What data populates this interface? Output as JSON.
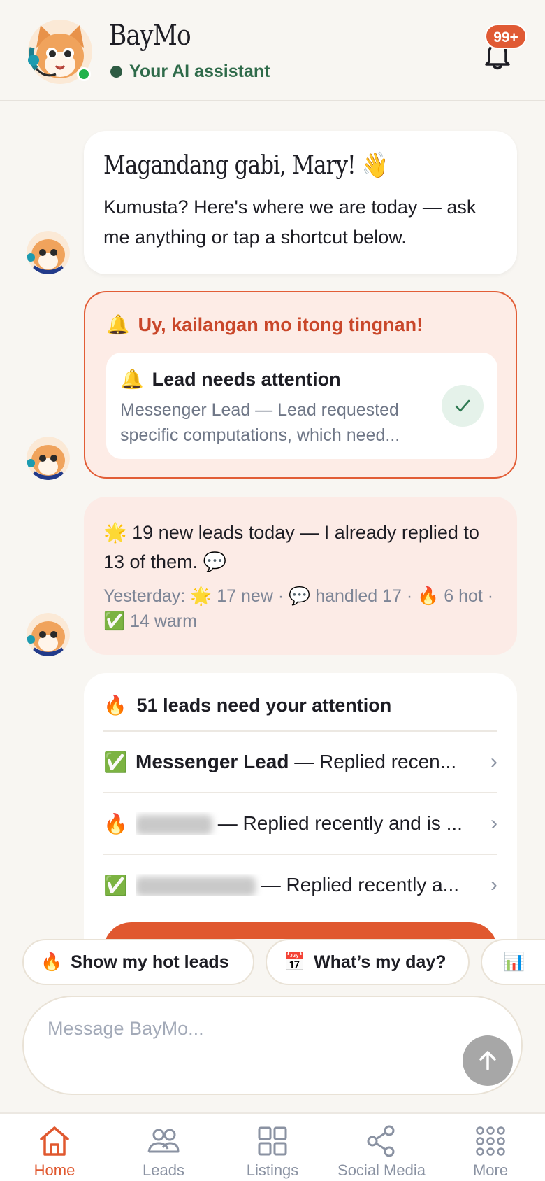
{
  "header": {
    "title": "BayMo",
    "subtitle": "Your AI assistant",
    "notification_count": "99+",
    "colors": {
      "accent": "#e0582f",
      "online": "#22b24c",
      "subtitle": "#2f6b4a"
    }
  },
  "messages": {
    "greeting": {
      "title": "Magandang gabi, Mary! 👋",
      "body": "Kumusta? Here's where we are today — ask me anything or tap a shortcut below."
    },
    "alert": {
      "title": "Uy, kailangan mo itong tingnan!",
      "card_title": "Lead needs attention",
      "card_desc": "Messenger Lead — Lead requested specific computations, which need..."
    },
    "stats": {
      "main": "19 new leads today — I already replied to 13 of them.",
      "yesterday_label": "Yesterday:",
      "new": "17 new",
      "handled": "handled 17",
      "hot": "6 hot",
      "warm": "14 warm"
    },
    "attention": {
      "title": "51 leads need your attention",
      "rows": [
        {
          "icon": "check-icon",
          "name": "Messenger Lead",
          "desc": "— Replied recen..."
        },
        {
          "icon": "fire-icon",
          "name": "",
          "desc": "— Replied recently and is ..."
        },
        {
          "icon": "check-icon",
          "name": "",
          "desc": "— Replied recently a..."
        }
      ]
    }
  },
  "chips": {
    "hot_leads": "Show my hot leads",
    "my_day": "What’s my day?"
  },
  "composer": {
    "placeholder": "Message BayMo..."
  },
  "nav": {
    "items": [
      {
        "label": "Home",
        "icon": "home-icon"
      },
      {
        "label": "Leads",
        "icon": "users-icon"
      },
      {
        "label": "Listings",
        "icon": "grid-icon"
      },
      {
        "label": "Social Media",
        "icon": "share-icon"
      },
      {
        "label": "More",
        "icon": "dots-icon"
      }
    ]
  }
}
